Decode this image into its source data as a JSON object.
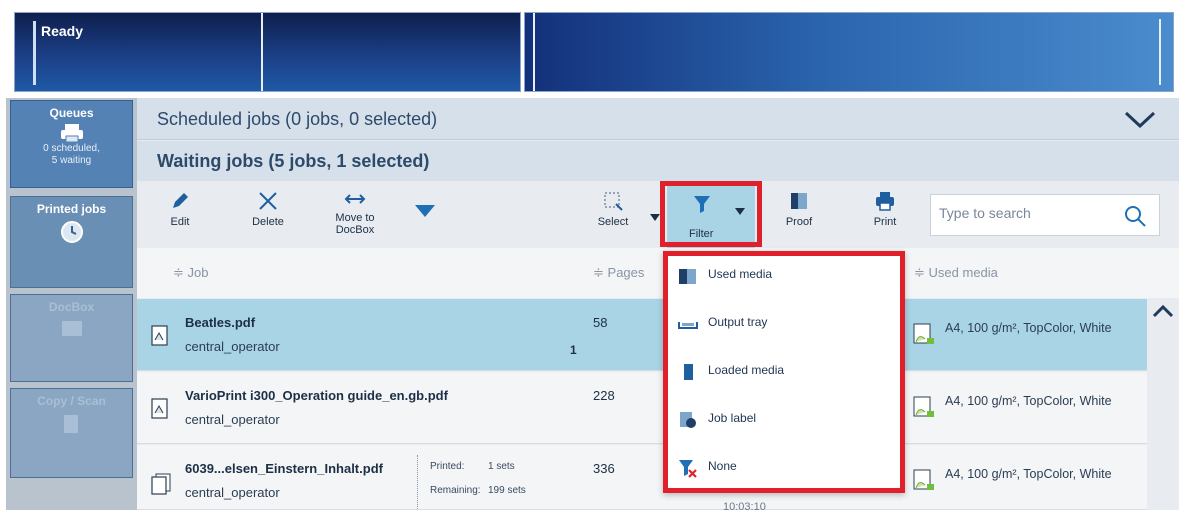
{
  "status": {
    "label": "Ready"
  },
  "nav": {
    "queues": {
      "title": "Queues",
      "line1": "0 scheduled,",
      "line2": "5 waiting"
    },
    "printed": {
      "title": "Printed jobs"
    },
    "docbox": {
      "title": "DocBox"
    },
    "copyscan": {
      "title": "Copy / Scan"
    }
  },
  "scheduled": {
    "title": "Scheduled jobs (0 jobs, 0 selected)"
  },
  "waiting": {
    "title": "Waiting jobs (5 jobs, 1 selected)"
  },
  "toolbar": {
    "edit": "Edit",
    "delete": "Delete",
    "move1": "Move to",
    "move2": "DocBox",
    "select": "Select",
    "filter": "Filter",
    "proof": "Proof",
    "print": "Print",
    "search_placeholder": "Type to search"
  },
  "columns": {
    "job": "Job",
    "pages": "Pages",
    "used_media": "Used media"
  },
  "sort_glyph": "≑",
  "rows": [
    {
      "name": "Beatles.pdf",
      "owner": "central_operator",
      "pages": "58",
      "copies": "1",
      "media": "A4, 100 g/m², TopColor, White"
    },
    {
      "name": "VarioPrint i300_Operation guide_en.gb.pdf",
      "owner": "central_operator",
      "pages": "228",
      "media": "A4, 100 g/m², TopColor, White"
    },
    {
      "name": "6039...elsen_Einstern_Inhalt.pdf",
      "owner": "central_operator",
      "pages": "336",
      "media": "A4, 100 g/m², TopColor, White",
      "printed_label": "Printed:",
      "printed_value": "1 sets",
      "remaining_label": "Remaining:",
      "remaining_value": "199 sets",
      "time_partial": "10:03:10"
    }
  ],
  "filter_menu": {
    "items": [
      {
        "label": "Used media",
        "icon": "used-media-icon"
      },
      {
        "label": "Output tray",
        "icon": "output-tray-icon"
      },
      {
        "label": "Loaded media",
        "icon": "loaded-media-icon"
      },
      {
        "label": "Job label",
        "icon": "job-label-icon"
      },
      {
        "label": "None",
        "icon": "filter-none-icon"
      }
    ]
  },
  "colors": {
    "accent": "#a9d4e6",
    "highlight": "#e0202a",
    "nav": "#6a8fb5"
  }
}
